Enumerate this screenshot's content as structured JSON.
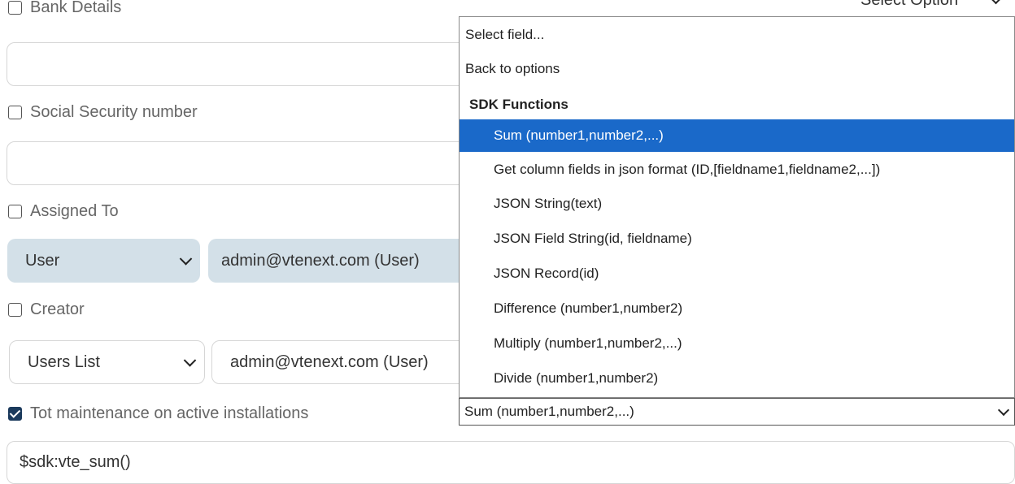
{
  "fields": {
    "bank_details": {
      "label": "Bank Details",
      "checked": false
    },
    "social_security": {
      "label": "Social Security number",
      "checked": false
    },
    "assigned_to": {
      "label": "Assigned To",
      "checked": false,
      "type_value": "User",
      "user_value": "admin@vtenext.com (User)"
    },
    "creator": {
      "label": "Creator",
      "checked": false,
      "type_value": "Users List",
      "user_value": "admin@vtenext.com (User)"
    },
    "tot_maintenance": {
      "label": "Tot maintenance on active installations",
      "checked": true,
      "value": "$sdk:vte_sum()"
    }
  },
  "top_right_select": {
    "label": "Select Option"
  },
  "dropdown": {
    "select_field": "Select field...",
    "back": "Back to options",
    "group_label": "SDK Functions",
    "options": [
      "Sum (number1,number2,...)",
      "Get column fields in json format (ID,[fieldname1,fieldname2,...])",
      "JSON String(text)",
      "JSON Field String(id, fieldname)",
      "JSON Record(id)",
      "Difference (number1,number2)",
      "Multiply (number1,number2,...)",
      "Divide (number1,number2)"
    ],
    "selected_index": 0
  },
  "function_select": {
    "value": "Sum (number1,number2,...)"
  },
  "colors": {
    "selected": "#1a69c9",
    "user_select_bg": "#d3e0e8",
    "checkbox_checked": "#1b3a5c"
  }
}
